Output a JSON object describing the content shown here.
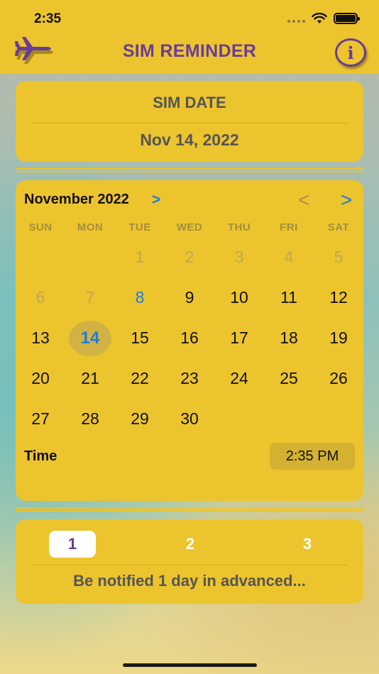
{
  "status_bar": {
    "time": "2:35"
  },
  "header": {
    "title": "SIM REMINDER",
    "left_icon": "airplane-icon",
    "right_icon": "info-icon",
    "info_glyph": "i"
  },
  "sim_date": {
    "label": "SIM DATE",
    "value": "Nov 14, 2022"
  },
  "calendar": {
    "month_label": "November 2022",
    "month_chevron": ">",
    "prev_glyph": "<",
    "next_glyph": ">",
    "weekdays": [
      "SUN",
      "MON",
      "TUE",
      "WED",
      "THU",
      "FRI",
      "SAT"
    ],
    "weeks": [
      [
        "",
        "",
        "1",
        "2",
        "3",
        "4",
        "5"
      ],
      [
        "6",
        "7",
        "8",
        "9",
        "10",
        "11",
        "12"
      ],
      [
        "13",
        "14",
        "15",
        "16",
        "17",
        "18",
        "19"
      ],
      [
        "20",
        "21",
        "22",
        "23",
        "24",
        "25",
        "26"
      ],
      [
        "27",
        "28",
        "29",
        "30",
        "",
        "",
        ""
      ]
    ],
    "today": "8",
    "selected": "14",
    "time_label": "Time",
    "time_value": "2:35 PM"
  },
  "notify": {
    "options": [
      "1",
      "2",
      "3"
    ],
    "selected": "1",
    "message": "Be notified  1  day in advanced..."
  },
  "colors": {
    "accent": "#ecc42e",
    "brand_purple": "#6a3c99",
    "link_blue": "#1a7de0"
  }
}
